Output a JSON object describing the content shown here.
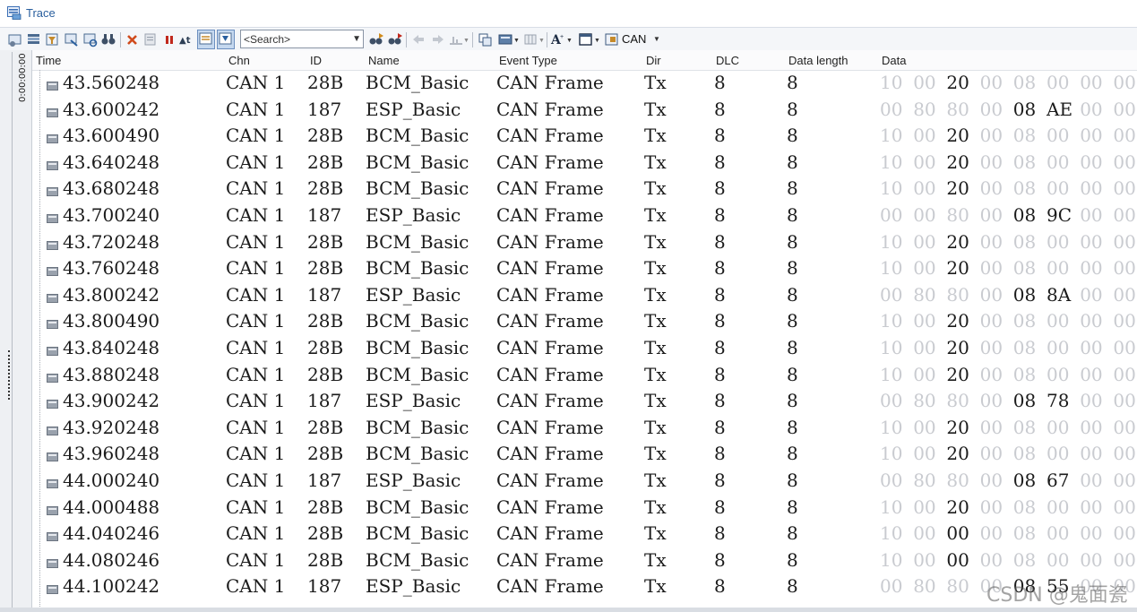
{
  "window": {
    "title": "Trace"
  },
  "toolbar": {
    "search_placeholder": "<Search>",
    "bus_label": "CAN",
    "icons": [
      "trace-config-icon",
      "detail-view-icon",
      "filter-icon",
      "trigger-icon",
      "analysis-icon",
      "binocular-icon",
      "clear-icon",
      "pause-icon",
      "stop-icon",
      "time-format-icon",
      "chronological-view-icon",
      "fixed-position-icon",
      "find-next-icon",
      "find-prev-icon",
      "nav-back-icon",
      "nav-forward-icon",
      "marker-icon",
      "copy-icon",
      "export-icon",
      "column-icon",
      "font-icon",
      "layout-icon",
      "can-bus-icon"
    ]
  },
  "sidebar": {
    "time_scale_label": "0:00:00:00"
  },
  "columns": [
    "Time",
    "Chn",
    "ID",
    "Name",
    "Event Type",
    "Dir",
    "DLC",
    "Data length",
    "Data"
  ],
  "rows": [
    {
      "time": "43.560248",
      "chn": "CAN 1",
      "id": "28B",
      "name": "BCM_Basic",
      "type": "CAN Frame",
      "dir": "Tx",
      "dlc": "8",
      "len": "8",
      "data": [
        "10",
        "00",
        "20",
        "00",
        "08",
        "00",
        "00",
        "00"
      ],
      "highlight": [
        2
      ]
    },
    {
      "time": "43.600242",
      "chn": "CAN 1",
      "id": "187",
      "name": "ESP_Basic",
      "type": "CAN Frame",
      "dir": "Tx",
      "dlc": "8",
      "len": "8",
      "data": [
        "00",
        "80",
        "80",
        "00",
        "08",
        "AE",
        "00",
        "00"
      ],
      "highlight": [
        4,
        5
      ]
    },
    {
      "time": "43.600490",
      "chn": "CAN 1",
      "id": "28B",
      "name": "BCM_Basic",
      "type": "CAN Frame",
      "dir": "Tx",
      "dlc": "8",
      "len": "8",
      "data": [
        "10",
        "00",
        "20",
        "00",
        "08",
        "00",
        "00",
        "00"
      ],
      "highlight": [
        2
      ]
    },
    {
      "time": "43.640248",
      "chn": "CAN 1",
      "id": "28B",
      "name": "BCM_Basic",
      "type": "CAN Frame",
      "dir": "Tx",
      "dlc": "8",
      "len": "8",
      "data": [
        "10",
        "00",
        "20",
        "00",
        "08",
        "00",
        "00",
        "00"
      ],
      "highlight": [
        2
      ]
    },
    {
      "time": "43.680248",
      "chn": "CAN 1",
      "id": "28B",
      "name": "BCM_Basic",
      "type": "CAN Frame",
      "dir": "Tx",
      "dlc": "8",
      "len": "8",
      "data": [
        "10",
        "00",
        "20",
        "00",
        "08",
        "00",
        "00",
        "00"
      ],
      "highlight": [
        2
      ]
    },
    {
      "time": "43.700240",
      "chn": "CAN 1",
      "id": "187",
      "name": "ESP_Basic",
      "type": "CAN Frame",
      "dir": "Tx",
      "dlc": "8",
      "len": "8",
      "data": [
        "00",
        "00",
        "80",
        "00",
        "08",
        "9C",
        "00",
        "00"
      ],
      "highlight": [
        4,
        5
      ]
    },
    {
      "time": "43.720248",
      "chn": "CAN 1",
      "id": "28B",
      "name": "BCM_Basic",
      "type": "CAN Frame",
      "dir": "Tx",
      "dlc": "8",
      "len": "8",
      "data": [
        "10",
        "00",
        "20",
        "00",
        "08",
        "00",
        "00",
        "00"
      ],
      "highlight": [
        2
      ]
    },
    {
      "time": "43.760248",
      "chn": "CAN 1",
      "id": "28B",
      "name": "BCM_Basic",
      "type": "CAN Frame",
      "dir": "Tx",
      "dlc": "8",
      "len": "8",
      "data": [
        "10",
        "00",
        "20",
        "00",
        "08",
        "00",
        "00",
        "00"
      ],
      "highlight": [
        2
      ]
    },
    {
      "time": "43.800242",
      "chn": "CAN 1",
      "id": "187",
      "name": "ESP_Basic",
      "type": "CAN Frame",
      "dir": "Tx",
      "dlc": "8",
      "len": "8",
      "data": [
        "00",
        "80",
        "80",
        "00",
        "08",
        "8A",
        "00",
        "00"
      ],
      "highlight": [
        4,
        5
      ]
    },
    {
      "time": "43.800490",
      "chn": "CAN 1",
      "id": "28B",
      "name": "BCM_Basic",
      "type": "CAN Frame",
      "dir": "Tx",
      "dlc": "8",
      "len": "8",
      "data": [
        "10",
        "00",
        "20",
        "00",
        "08",
        "00",
        "00",
        "00"
      ],
      "highlight": [
        2
      ]
    },
    {
      "time": "43.840248",
      "chn": "CAN 1",
      "id": "28B",
      "name": "BCM_Basic",
      "type": "CAN Frame",
      "dir": "Tx",
      "dlc": "8",
      "len": "8",
      "data": [
        "10",
        "00",
        "20",
        "00",
        "08",
        "00",
        "00",
        "00"
      ],
      "highlight": [
        2
      ]
    },
    {
      "time": "43.880248",
      "chn": "CAN 1",
      "id": "28B",
      "name": "BCM_Basic",
      "type": "CAN Frame",
      "dir": "Tx",
      "dlc": "8",
      "len": "8",
      "data": [
        "10",
        "00",
        "20",
        "00",
        "08",
        "00",
        "00",
        "00"
      ],
      "highlight": [
        2
      ]
    },
    {
      "time": "43.900242",
      "chn": "CAN 1",
      "id": "187",
      "name": "ESP_Basic",
      "type": "CAN Frame",
      "dir": "Tx",
      "dlc": "8",
      "len": "8",
      "data": [
        "00",
        "80",
        "80",
        "00",
        "08",
        "78",
        "00",
        "00"
      ],
      "highlight": [
        4,
        5
      ]
    },
    {
      "time": "43.920248",
      "chn": "CAN 1",
      "id": "28B",
      "name": "BCM_Basic",
      "type": "CAN Frame",
      "dir": "Tx",
      "dlc": "8",
      "len": "8",
      "data": [
        "10",
        "00",
        "20",
        "00",
        "08",
        "00",
        "00",
        "00"
      ],
      "highlight": [
        2
      ]
    },
    {
      "time": "43.960248",
      "chn": "CAN 1",
      "id": "28B",
      "name": "BCM_Basic",
      "type": "CAN Frame",
      "dir": "Tx",
      "dlc": "8",
      "len": "8",
      "data": [
        "10",
        "00",
        "20",
        "00",
        "08",
        "00",
        "00",
        "00"
      ],
      "highlight": [
        2
      ]
    },
    {
      "time": "44.000240",
      "chn": "CAN 1",
      "id": "187",
      "name": "ESP_Basic",
      "type": "CAN Frame",
      "dir": "Tx",
      "dlc": "8",
      "len": "8",
      "data": [
        "00",
        "80",
        "80",
        "00",
        "08",
        "67",
        "00",
        "00"
      ],
      "highlight": [
        4,
        5
      ]
    },
    {
      "time": "44.000488",
      "chn": "CAN 1",
      "id": "28B",
      "name": "BCM_Basic",
      "type": "CAN Frame",
      "dir": "Tx",
      "dlc": "8",
      "len": "8",
      "data": [
        "10",
        "00",
        "20",
        "00",
        "08",
        "00",
        "00",
        "00"
      ],
      "highlight": [
        2
      ]
    },
    {
      "time": "44.040246",
      "chn": "CAN 1",
      "id": "28B",
      "name": "BCM_Basic",
      "type": "CAN Frame",
      "dir": "Tx",
      "dlc": "8",
      "len": "8",
      "data": [
        "10",
        "00",
        "00",
        "00",
        "08",
        "00",
        "00",
        "00"
      ],
      "highlight": [
        2
      ]
    },
    {
      "time": "44.080246",
      "chn": "CAN 1",
      "id": "28B",
      "name": "BCM_Basic",
      "type": "CAN Frame",
      "dir": "Tx",
      "dlc": "8",
      "len": "8",
      "data": [
        "10",
        "00",
        "00",
        "00",
        "08",
        "00",
        "00",
        "00"
      ],
      "highlight": [
        2
      ]
    },
    {
      "time": "44.100242",
      "chn": "CAN 1",
      "id": "187",
      "name": "ESP_Basic",
      "type": "CAN Frame",
      "dir": "Tx",
      "dlc": "8",
      "len": "8",
      "data": [
        "00",
        "80",
        "80",
        "00",
        "08",
        "55",
        "00",
        "00"
      ],
      "highlight": [
        4,
        5
      ]
    }
  ],
  "watermark": "CSDN @鬼面瓷",
  "colors": {
    "accent": "#2a5f9e",
    "text": "#1b1b1b",
    "dim_byte": "#c9cbd0",
    "toolbar_bg": "#f4f6f9"
  }
}
